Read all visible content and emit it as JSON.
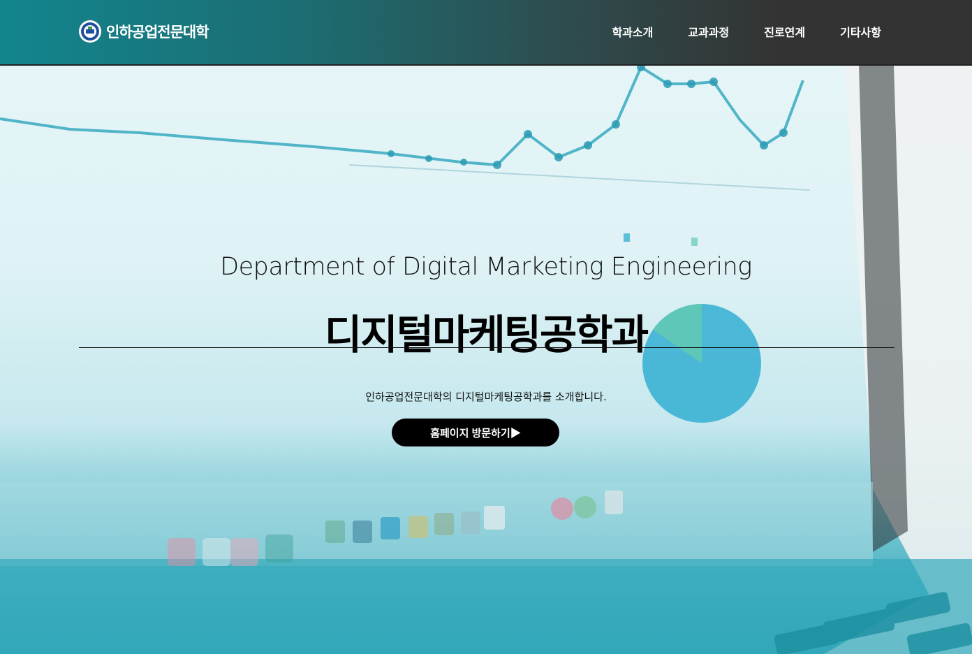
{
  "header": {
    "brand_name": "인하공업전문대학",
    "menu": [
      {
        "label": "학과소개"
      },
      {
        "label": "교과과정"
      },
      {
        "label": "진로연계"
      },
      {
        "label": "기타사항"
      }
    ]
  },
  "hero": {
    "title_en": "Department of Digital Marketing Engineering",
    "title_ko": "디지털마케팅공학과",
    "description": "인하공업전문대학의 디지털마케팅공학과를 소개합니다.",
    "button_label": "홈페이지 방문하기▶"
  },
  "colors": {
    "nav_left": "#13858e",
    "nav_right": "#333333",
    "button_bg": "#000000",
    "teal_accent": "#2aa3b5"
  }
}
